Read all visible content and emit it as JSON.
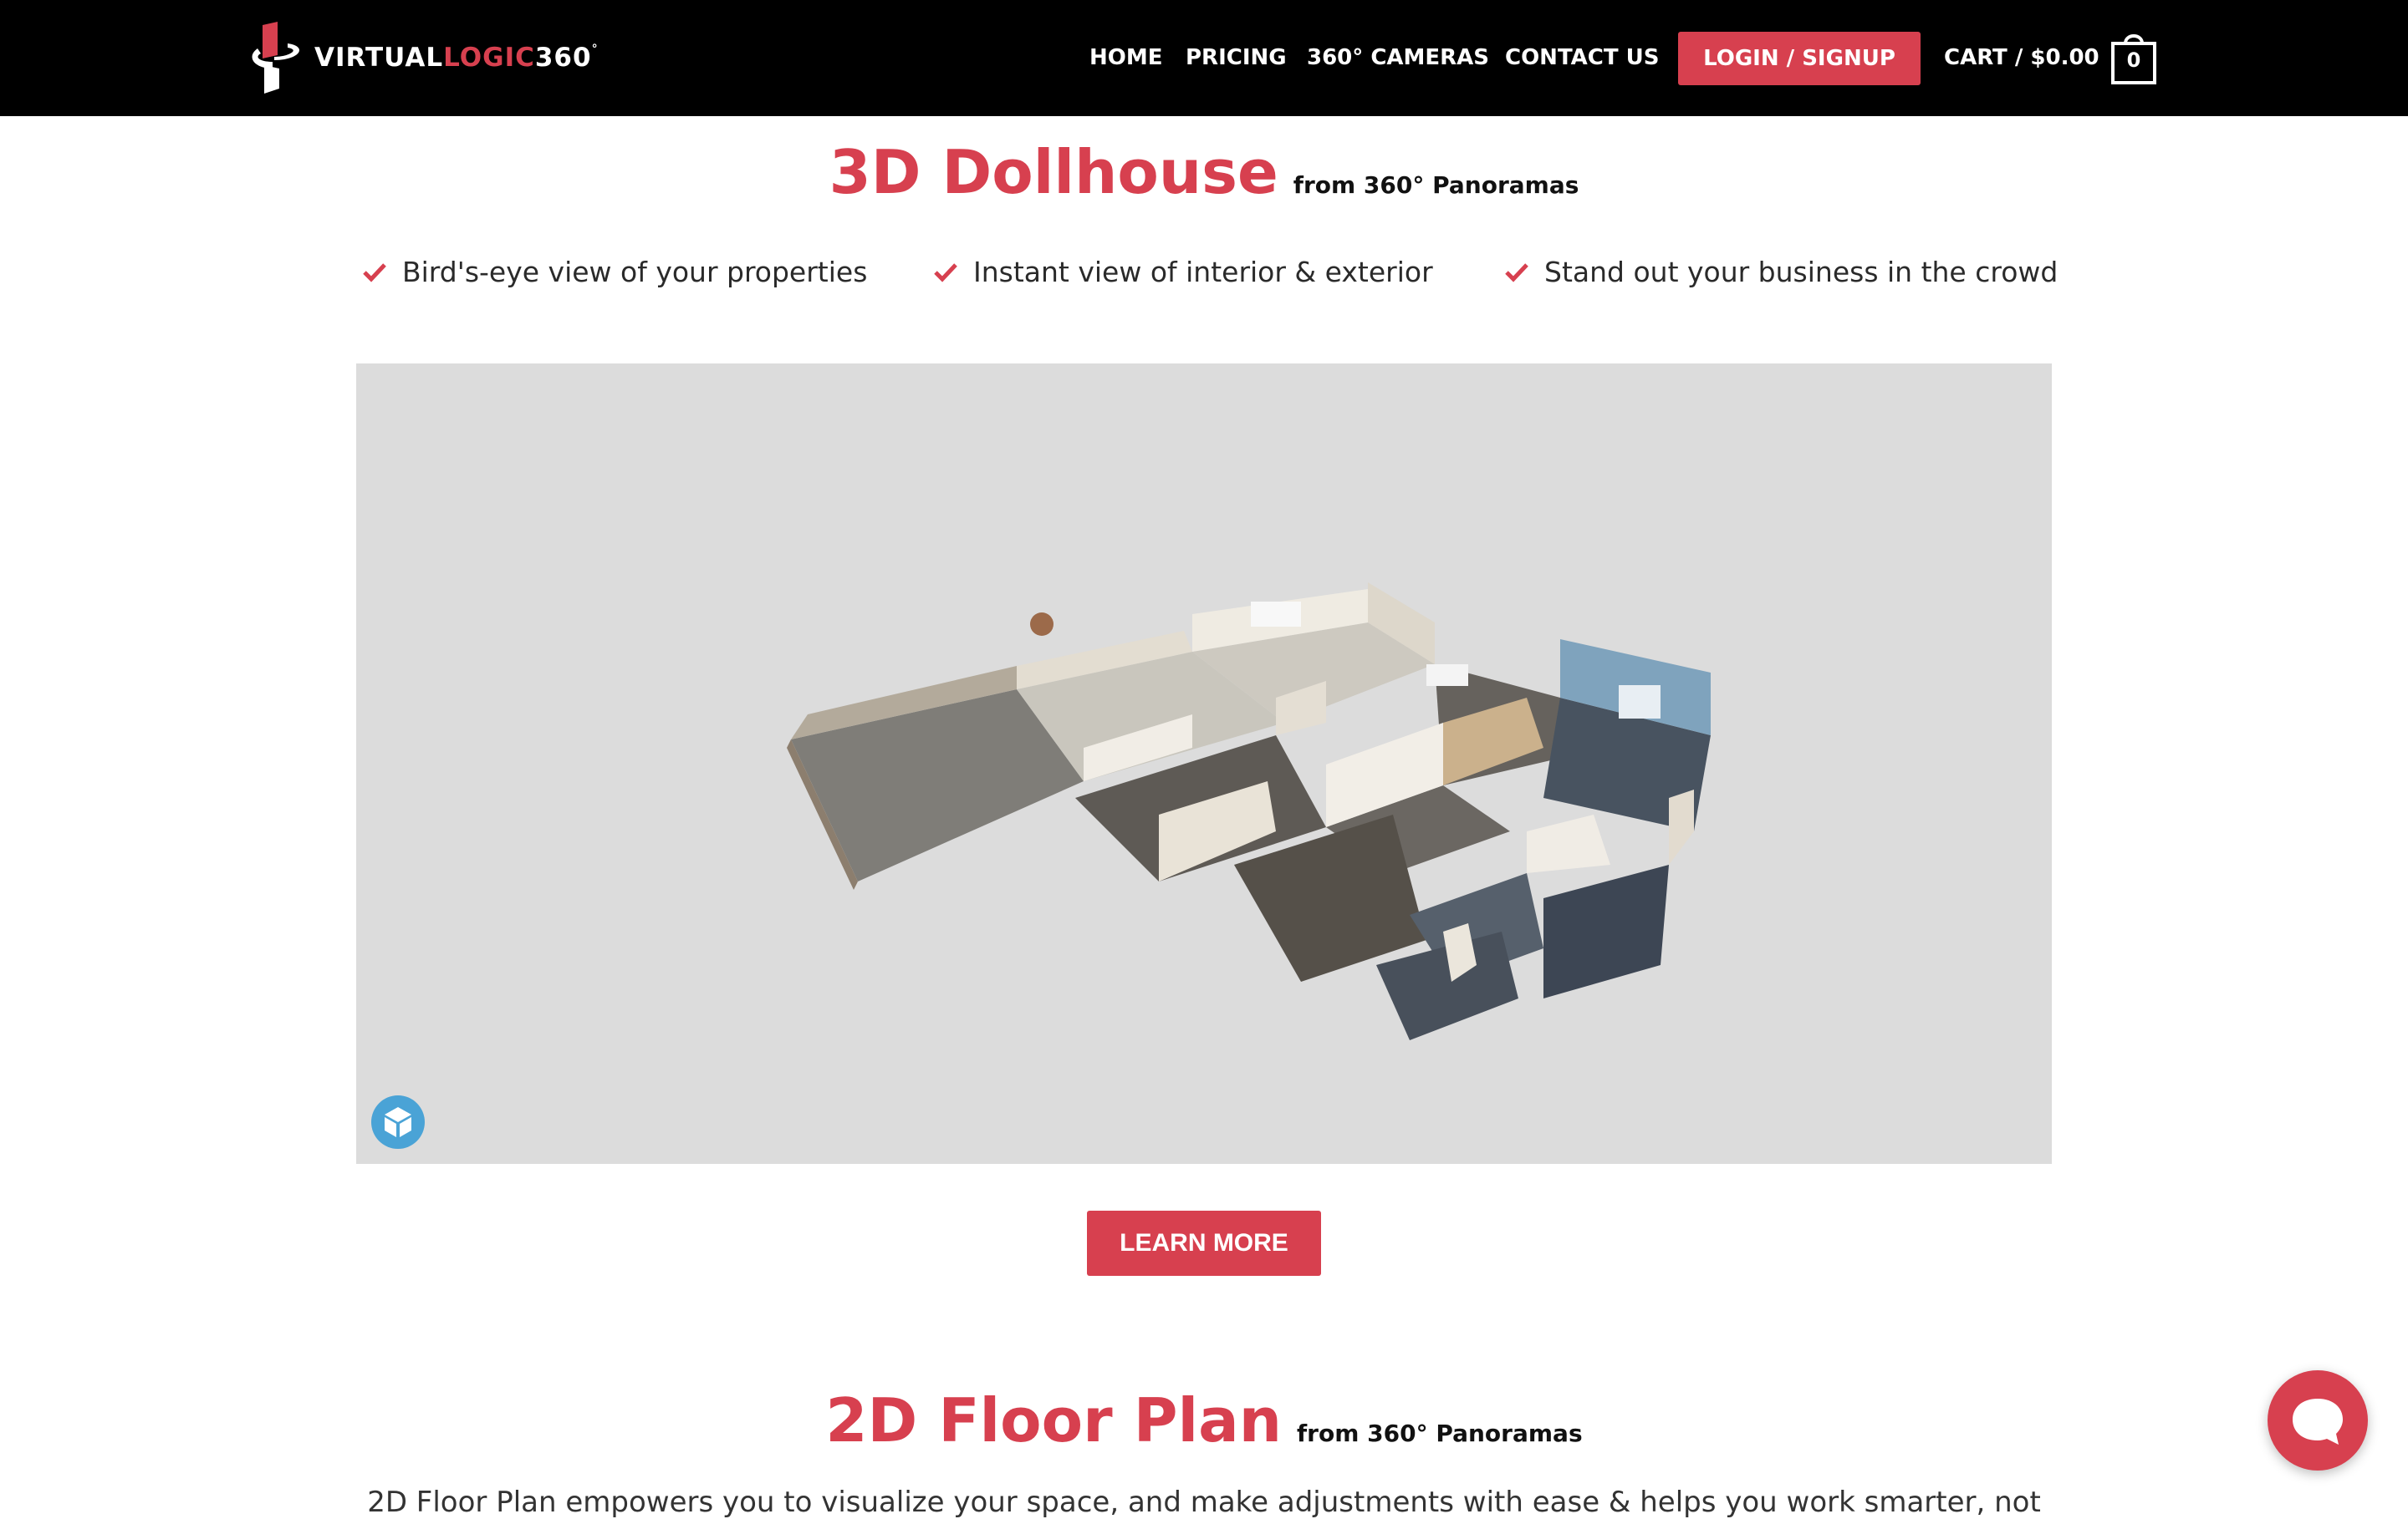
{
  "header": {
    "logo": {
      "part1": "VIRTUAL",
      "part2": "LOGIC",
      "part3": "360",
      "degree": "°"
    },
    "nav": [
      {
        "label": "HOME"
      },
      {
        "label": "PRICING"
      },
      {
        "label": "360° CAMERAS"
      },
      {
        "label": "CONTACT US"
      }
    ],
    "login_label": "LOGIN / SIGNUP",
    "cart_label": "CART / $0.00",
    "cart_count": "0"
  },
  "dollhouse": {
    "title": "3D Dollhouse",
    "subtitle": "from 360° Panoramas",
    "features": [
      {
        "text": "Bird's-eye view of your properties"
      },
      {
        "text": "Instant view of interior & exterior"
      },
      {
        "text": "Stand out your business in the crowd"
      }
    ],
    "learn_more_label": "LEARN MORE"
  },
  "floorplan": {
    "title": "2D Floor Plan",
    "subtitle": "from 360° Panoramas",
    "body": "2D Floor Plan empowers you to visualize your space, and make adjustments with ease & helps you work smarter, not"
  },
  "colors": {
    "accent": "#d7404f",
    "header_bg": "#000000",
    "viewer_bg": "#dcdcdc",
    "viewer_icon": "#4aa3d6"
  },
  "icons": {
    "logo": "logo-icon",
    "cart": "bag-icon",
    "check": "check-icon",
    "viewer": "cube-icon",
    "chat": "chat-bubble-icon"
  }
}
